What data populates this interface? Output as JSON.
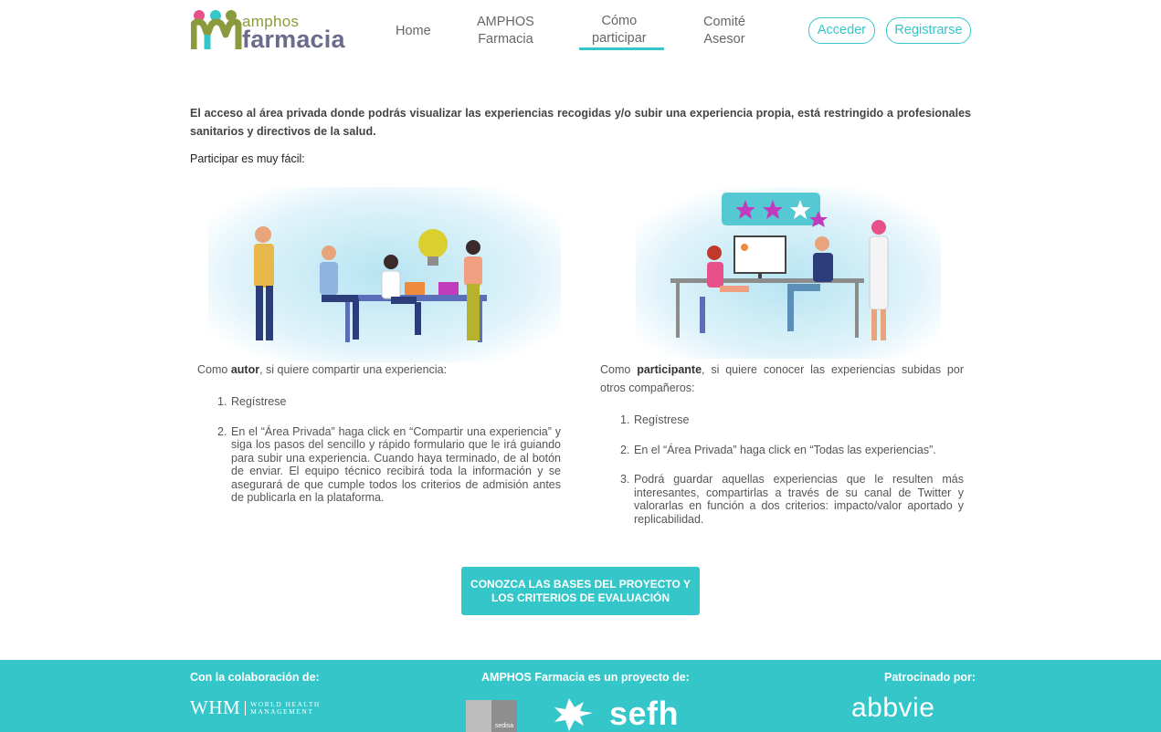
{
  "header": {
    "logo_top": "amphos",
    "logo_main": "farmacia",
    "nav": [
      {
        "label_1": "Home",
        "label_2": ""
      },
      {
        "label_1": "AMPHOS",
        "label_2": "Farmacia"
      },
      {
        "label_1": "Cómo",
        "label_2": "participar"
      },
      {
        "label_1": "Comité",
        "label_2": "Asesor"
      }
    ],
    "login": "Acceder",
    "register": "Registrarse"
  },
  "intro": {
    "restricted": "El acceso al área privada donde podrás visualizar las experiencias recogidas y/o subir una experiencia propia, está restringido a profesionales sanitarios y directivos de la salud.",
    "easy": "Participar es muy fácil:"
  },
  "author": {
    "prefix": "Como ",
    "role": "autor",
    "suffix": ", si quiere compartir una experiencia:",
    "steps": [
      "Regístrese",
      "En el “Área Privada” haga click en “Compartir una experiencia” y siga los pasos del sencillo y rápido formulario que le irá guiando para subir una experiencia. Cuando haya terminado, de al botón de enviar. El equipo técnico recibirá toda la información y se asegurará de que cumple todos los criterios de admisión antes de publicarla en la plataforma."
    ]
  },
  "participant": {
    "prefix": "Como ",
    "role": "participante",
    "suffix": ", si quiere conocer las experiencias subidas por otros compañeros:",
    "steps": [
      "Regístrese",
      "En el “Área Privada” haga click en “Todas las experiencias”.",
      "Podrá guardar aquellas experiencias que le resulten más interesantes, compartirlas a través de su canal de Twitter y valorarlas en función a dos criterios: impacto/valor aportado y replicabilidad."
    ]
  },
  "cta": "CONOZCA LAS BASES DEL PROYECTO Y LOS CRITERIOS DE EVALUACIÓN",
  "footer": {
    "collab": "Con la colaboración de:",
    "project": "AMPHOS Farmacia es un proyecto de:",
    "sponsor": "Patrocinado por:",
    "whm_big": "WHM",
    "whm_small_1": "WORLD HEALTH",
    "whm_small_2": "MANAGEMENT",
    "sedisa": "sedisa",
    "sefh": "sefh",
    "abbvie": "abbvie"
  },
  "colors": {
    "accent": "#34c6c9",
    "logo_green": "#8a9a3c",
    "logo_purple": "#6b6b8c"
  }
}
